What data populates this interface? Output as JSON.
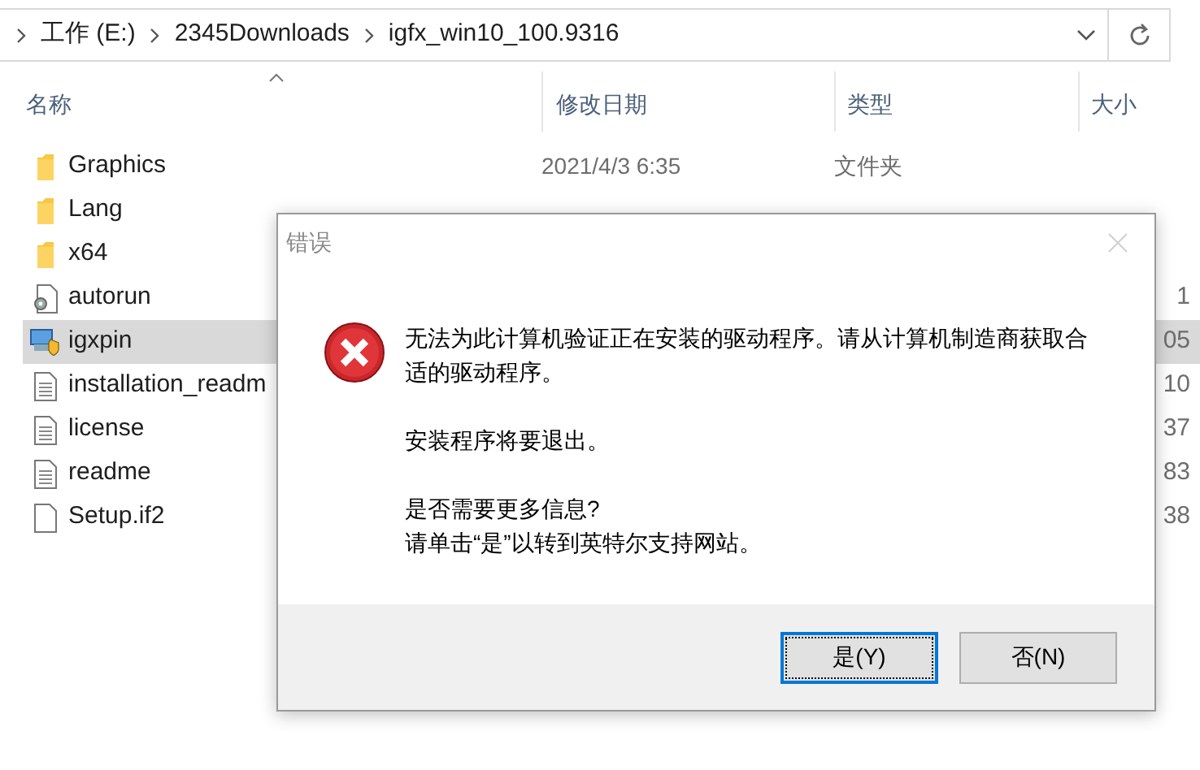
{
  "address_bar": {
    "breadcrumbs": [
      "工作 (E:)",
      "2345Downloads",
      "igfx_win10_100.9316"
    ]
  },
  "columns": [
    {
      "label": "名称",
      "sorted": true
    },
    {
      "label": "修改日期",
      "sorted": false
    },
    {
      "label": "类型",
      "sorted": false
    },
    {
      "label": "大小",
      "sorted": false
    }
  ],
  "rows": [
    {
      "kind": "folder",
      "name": "Graphics",
      "date": "2021/4/3 6:35",
      "type": "文件夹",
      "selected": false
    },
    {
      "kind": "folder",
      "name": "Lang",
      "selected": false
    },
    {
      "kind": "folder",
      "name": "x64",
      "selected": false
    },
    {
      "kind": "settings",
      "name": "autorun",
      "size": "1",
      "selected": false
    },
    {
      "kind": "installer",
      "name": "igxpin",
      "size": "05",
      "selected": true
    },
    {
      "kind": "document",
      "name": "installation_readm",
      "size": "10",
      "selected": false
    },
    {
      "kind": "document",
      "name": "license",
      "size": "37",
      "selected": false
    },
    {
      "kind": "document",
      "name": "readme",
      "size": "83",
      "selected": false
    },
    {
      "kind": "file",
      "name": "Setup.if2",
      "size": "38",
      "selected": false
    }
  ],
  "dialog": {
    "title": "错误",
    "message": [
      "无法为此计算机验证正在安装的驱动程序。请从计算机制造商获取合适的驱动程序。",
      "安装程序将要退出。",
      "是否需要更多信息?",
      "请单击“是”以转到英特尔支持网站。"
    ],
    "buttons": [
      {
        "label": "是(Y)",
        "focused": true
      },
      {
        "label": "否(N)",
        "focused": false
      }
    ]
  }
}
